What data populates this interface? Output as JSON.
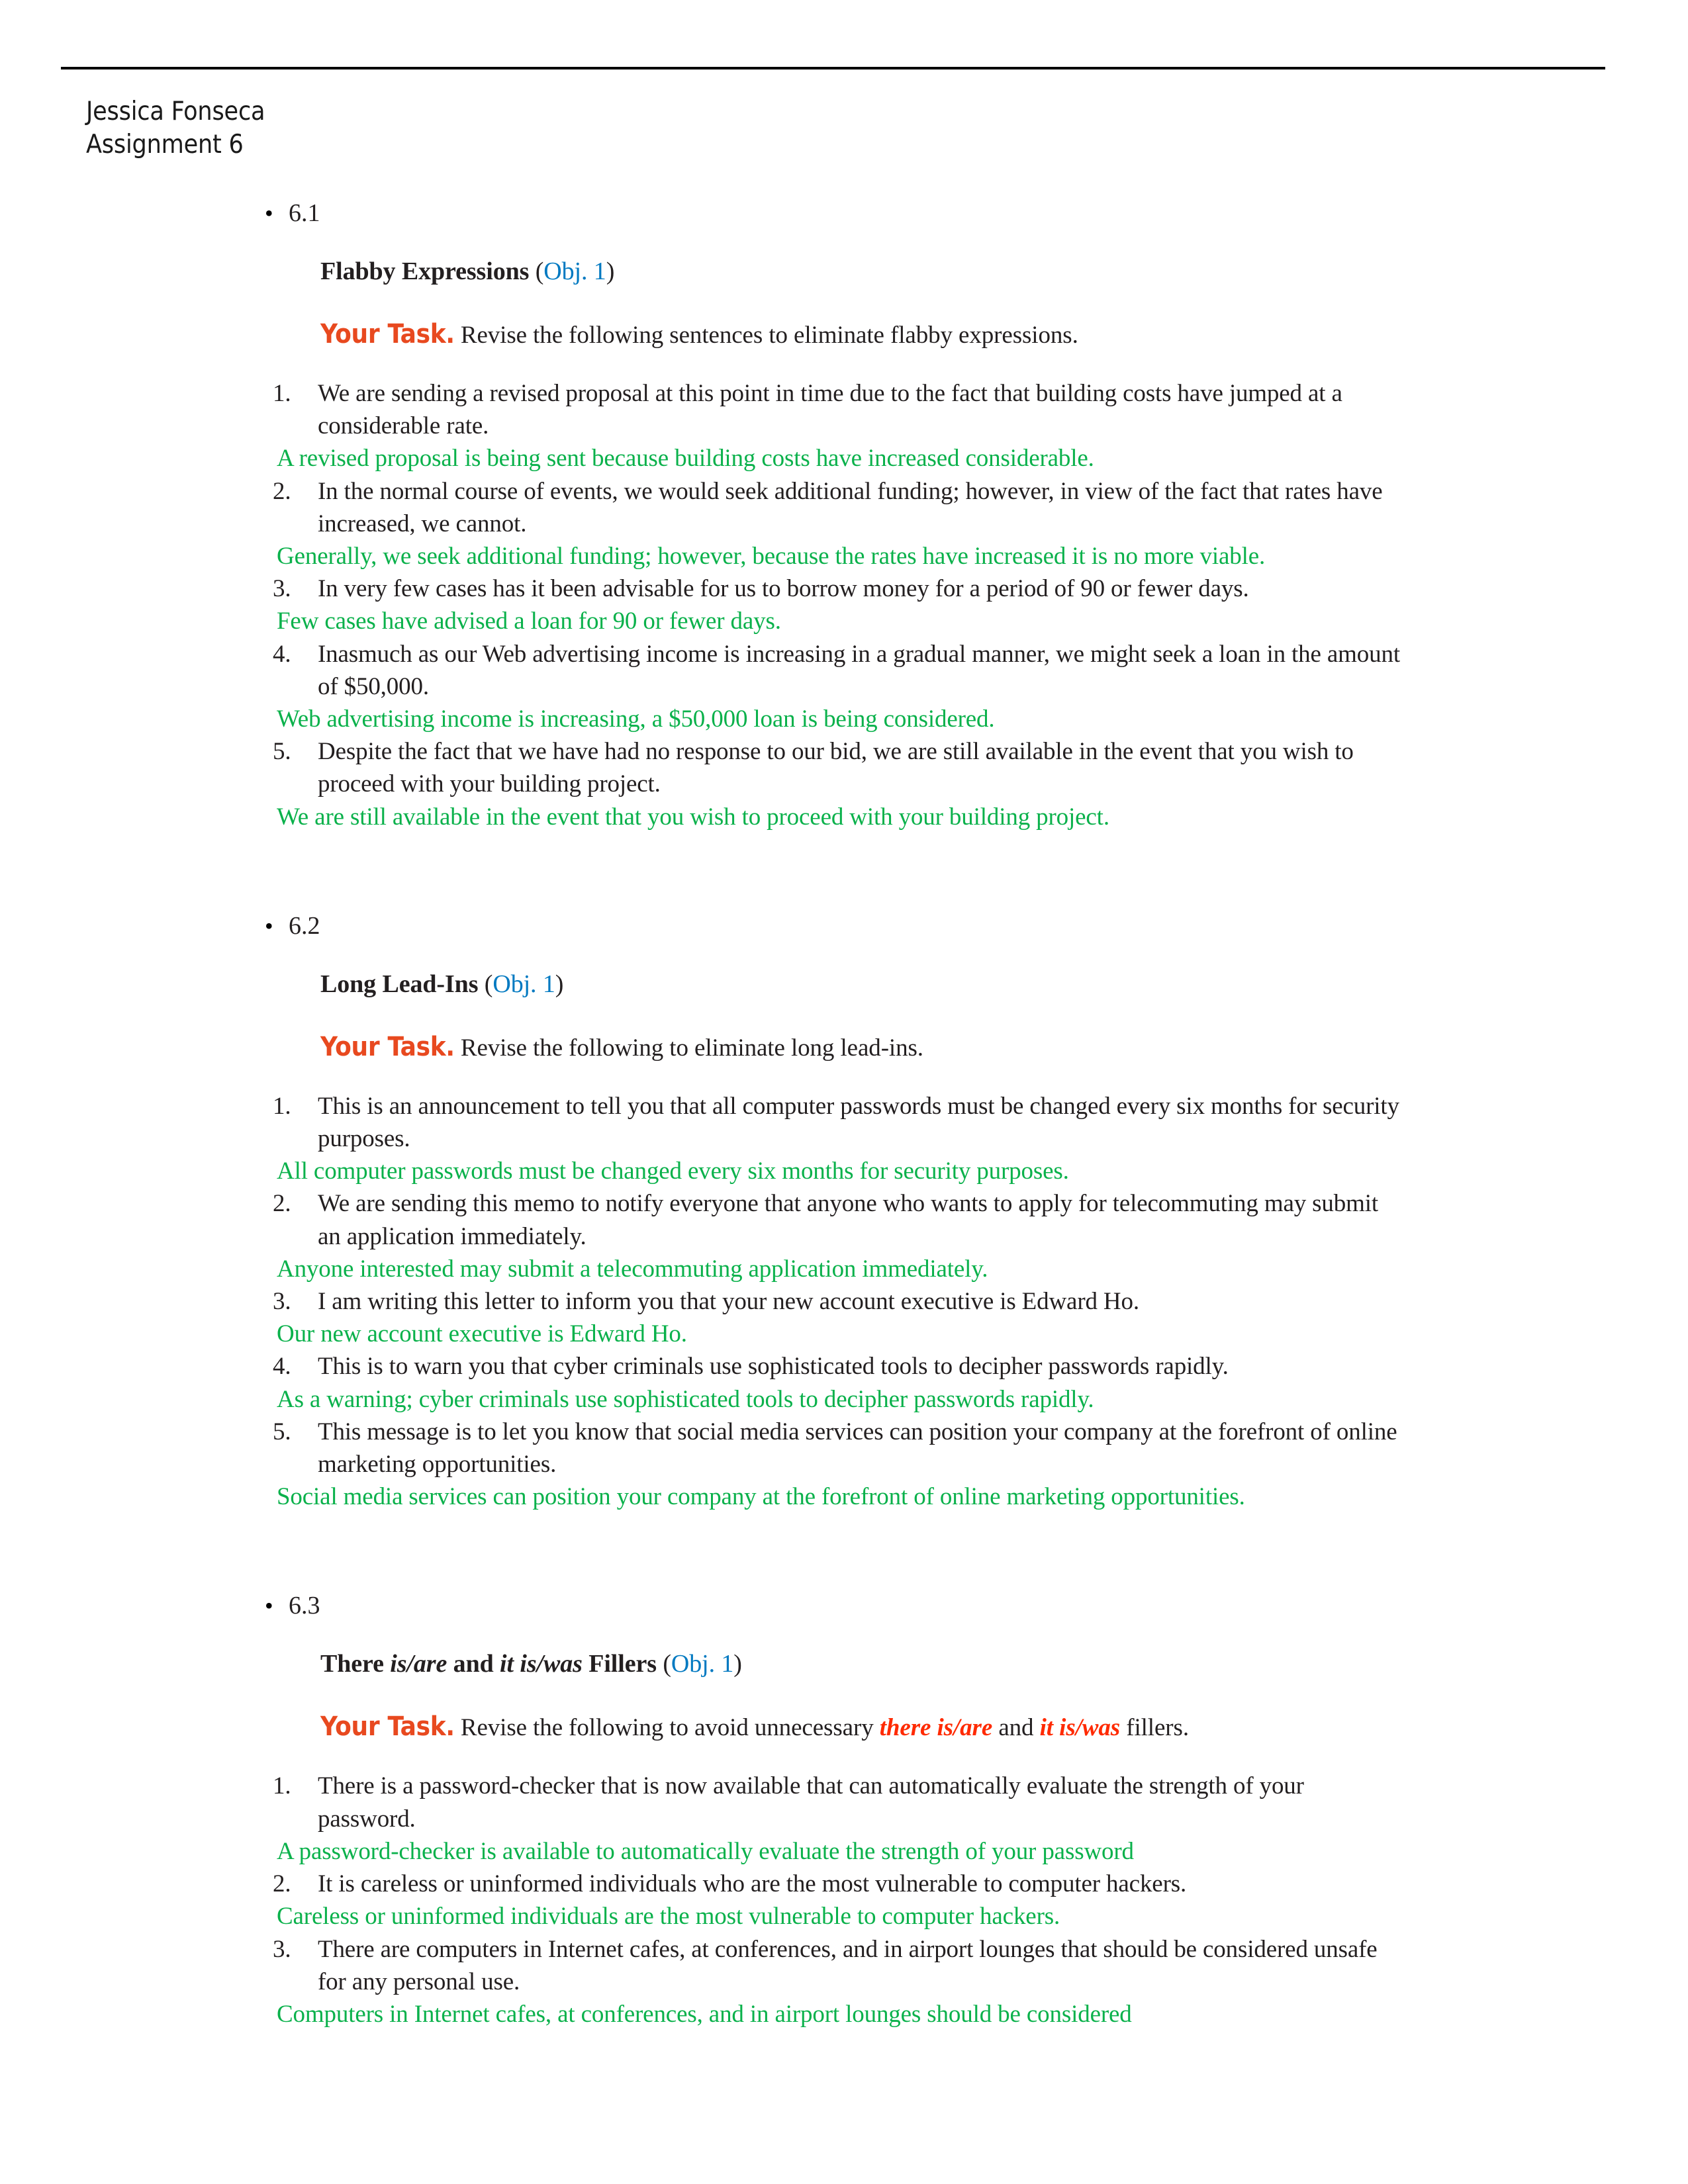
{
  "header": {
    "author_name": "Jessica Fonseca",
    "assignment": "Assignment 6"
  },
  "colors": {
    "answer_green": "#0AB14B",
    "objective_blue": "#0079C1",
    "your_task_orange": "#E8491F",
    "filler_red": "#FF2A00",
    "body_text": "#231F20"
  },
  "sections": [
    {
      "number": "6.1",
      "heading_main": "Flabby Expressions ",
      "heading_obj": "Obj. 1",
      "task_label": "Your Task.",
      "task_rest": " Revise the following sentences to eliminate flabby expressions.",
      "items": [
        {
          "num": "1.",
          "question": "We are sending a revised proposal at this point in time due to the fact that building costs have jumped at a considerable rate.",
          "answer": "A revised proposal is being sent because building costs have increased considerable."
        },
        {
          "num": "2.",
          "question": "In the normal course of events, we would seek additional funding; however, in view of the fact that rates have increased, we cannot.",
          "answer": "Generally, we seek additional funding; however, because the rates have increased it is no more viable."
        },
        {
          "num": "3.",
          "question": "In very few cases has it been advisable for us to borrow money for a period of 90 or fewer days.",
          "answer": "Few cases have advised a loan for 90 or fewer days."
        },
        {
          "num": "4.",
          "question": "Inasmuch as our Web advertising income is increasing in a gradual manner, we might seek a loan in the amount of $50,000.",
          "answer": "Web advertising income is increasing, a $50,000 loan is being considered."
        },
        {
          "num": "5.",
          "question": "Despite the fact that we have had no response to our bid, we are still available in the event that you wish to proceed with your building project.",
          "answer": "We are still available in the event that you wish to proceed with your building project."
        }
      ]
    },
    {
      "number": "6.2",
      "heading_main": "Long Lead-Ins ",
      "heading_obj": "Obj. 1",
      "task_label": "Your Task.",
      "task_rest": " Revise the following to eliminate long lead-ins.",
      "items": [
        {
          "num": "1.",
          "question": "This is an announcement to tell you that all computer passwords must be changed every six months for security purposes.",
          "answer": "All computer passwords must be changed every six months for security purposes."
        },
        {
          "num": "2.",
          "question": "We are sending this memo to notify everyone that anyone who wants to apply for telecommuting may submit an application immediately.",
          "answer": "Anyone interested may submit a telecommuting application immediately."
        },
        {
          "num": "3.",
          "question": "I am writing this letter to inform you that your new account executive is Edward Ho.",
          "answer": "Our new account executive is Edward Ho."
        },
        {
          "num": "4.",
          "question": "This is to warn you that cyber criminals use sophisticated tools to decipher passwords rapidly.",
          "answer": "As a warning; cyber criminals use sophisticated tools to decipher passwords rapidly."
        },
        {
          "num": "5.",
          "question": "This message is to let you know that social media services can position your company at the forefront of online marketing opportunities.",
          "answer": "Social media services can position your company at the forefront of online marketing opportunities."
        }
      ]
    },
    {
      "number": "6.3",
      "heading_parts": [
        {
          "text": "There ",
          "style": "bold"
        },
        {
          "text": "is/are",
          "style": "bold-italic"
        },
        {
          "text": " and ",
          "style": "bold"
        },
        {
          "text": "it is/was",
          "style": "bold-italic"
        },
        {
          "text": " Fillers ",
          "style": "bold"
        }
      ],
      "heading_obj": "Obj. 1",
      "task_label": "Your Task.",
      "task_parts": [
        {
          "text": " Revise the following to avoid unnecessary ",
          "style": "plain"
        },
        {
          "text": "there is/are",
          "style": "red-italic"
        },
        {
          "text": " and ",
          "style": "plain"
        },
        {
          "text": "it is/was",
          "style": "red-italic"
        },
        {
          "text": " fillers.",
          "style": "plain"
        }
      ],
      "items": [
        {
          "num": "1.",
          "question": "There is a password-checker that is now available that can automatically evaluate the strength of your password.",
          "answer": "A password-checker is available to automatically evaluate the strength of your password"
        },
        {
          "num": "2.",
          "question": "It is careless or uninformed individuals who are the most vulnerable to computer hackers.",
          "answer": "Careless or uninformed individuals are the most vulnerable to computer hackers."
        },
        {
          "num": "3.",
          "question": "There are computers in Internet cafes, at conferences, and in airport lounges that should be considered unsafe for any personal use.",
          "answer": "Computers in Internet cafes, at conferences, and in airport lounges should be considered"
        }
      ]
    }
  ]
}
